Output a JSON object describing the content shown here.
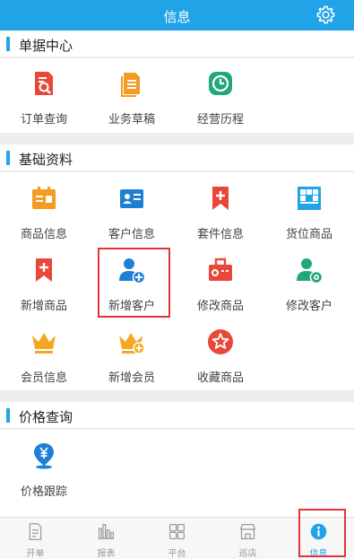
{
  "header": {
    "title": "信息",
    "settings_icon": "gear-icon"
  },
  "sections": [
    {
      "title": "单据中心",
      "items": [
        {
          "label": "订单查询",
          "icon": "order-search-icon",
          "color": "#e8473a"
        },
        {
          "label": "业务草稿",
          "icon": "draft-document-icon",
          "color": "#f59a23"
        },
        {
          "label": "经营历程",
          "icon": "clock-icon",
          "color": "#22a77c"
        }
      ]
    },
    {
      "title": "基础资料",
      "items": [
        {
          "label": "商品信息",
          "icon": "product-info-icon",
          "color": "#f59a23"
        },
        {
          "label": "客户信息",
          "icon": "contact-card-icon",
          "color": "#1e7fd6"
        },
        {
          "label": "套件信息",
          "icon": "bookmark-plus-icon",
          "color": "#e8473a"
        },
        {
          "label": "货位商品",
          "icon": "shelf-icon",
          "color": "#21a3e8"
        },
        {
          "label": "新增商品",
          "icon": "bookmark-plus-icon",
          "color": "#e8473a"
        },
        {
          "label": "新增客户",
          "icon": "user-add-icon",
          "color": "#1e7fd6"
        },
        {
          "label": "修改商品",
          "icon": "box-edit-icon",
          "color": "#e8473a"
        },
        {
          "label": "修改客户",
          "icon": "user-settings-icon",
          "color": "#22a77c"
        },
        {
          "label": "会员信息",
          "icon": "crown-icon",
          "color": "#f5a623"
        },
        {
          "label": "新增会员",
          "icon": "crown-add-icon",
          "color": "#f5a623"
        },
        {
          "label": "收藏商品",
          "icon": "star-badge-icon",
          "color": "#e8473a"
        }
      ]
    },
    {
      "title": "价格查询",
      "items": [
        {
          "label": "价格跟踪",
          "icon": "price-location-icon",
          "color": "#1e7fd6"
        }
      ]
    }
  ],
  "tabbar": [
    {
      "label": "开单",
      "icon": "document-icon",
      "active": false
    },
    {
      "label": "报表",
      "icon": "bar-chart-icon",
      "active": false
    },
    {
      "label": "平台",
      "icon": "grid-icon",
      "active": false
    },
    {
      "label": "巡店",
      "icon": "store-icon",
      "active": false
    },
    {
      "label": "信息",
      "icon": "info-icon",
      "active": true
    }
  ],
  "colors": {
    "accent": "#21a3e8",
    "highlight": "#e2343a"
  }
}
